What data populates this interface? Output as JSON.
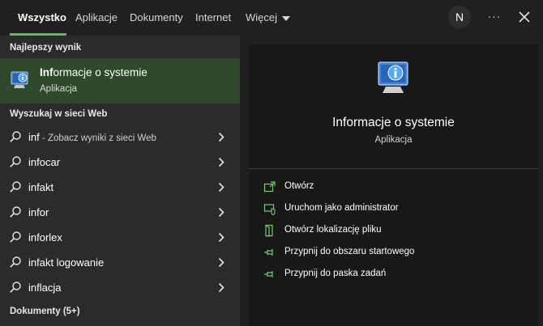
{
  "tabs": [
    {
      "label": "Wszystko"
    },
    {
      "label": "Aplikacje"
    },
    {
      "label": "Dokumenty"
    },
    {
      "label": "Internet"
    },
    {
      "label": "Więcej"
    }
  ],
  "header": {
    "avatar_initial": "N",
    "more_label": "···"
  },
  "left": {
    "best_match_heading": "Najlepszy wynik",
    "best_match": {
      "title_bold": "Inf",
      "title_rest": "ormacje o systemie",
      "subtitle": "Aplikacja"
    },
    "web_heading": "Wyszukaj w sieci Web",
    "web_results": [
      {
        "bold": "",
        "text": "inf",
        "hint": " - Zobacz wyniki z sieci Web"
      },
      {
        "bold": "",
        "text": "infocar",
        "hint": ""
      },
      {
        "bold": "",
        "text": "infakt",
        "hint": ""
      },
      {
        "bold": "",
        "text": "infor",
        "hint": ""
      },
      {
        "bold": "",
        "text": "inforlex",
        "hint": ""
      },
      {
        "bold": "",
        "text": "infakt logowanie",
        "hint": ""
      },
      {
        "bold": "",
        "text": "inflacja",
        "hint": ""
      }
    ],
    "documents_heading": "Dokumenty (5+)"
  },
  "right": {
    "title": "Informacje o systemie",
    "subtitle": "Aplikacja",
    "actions": [
      {
        "label": "Otwórz",
        "icon": "open-icon"
      },
      {
        "label": "Uruchom jako administrator",
        "icon": "shield-icon"
      },
      {
        "label": "Otwórz lokalizację pliku",
        "icon": "folder-icon"
      },
      {
        "label": "Przypnij do obszaru startowego",
        "icon": "pin-icon"
      },
      {
        "label": "Przypnij do paska zadań",
        "icon": "pin-icon"
      }
    ]
  },
  "colors": {
    "accent": "#5fb85f",
    "highlight": "#2f4a2b"
  }
}
